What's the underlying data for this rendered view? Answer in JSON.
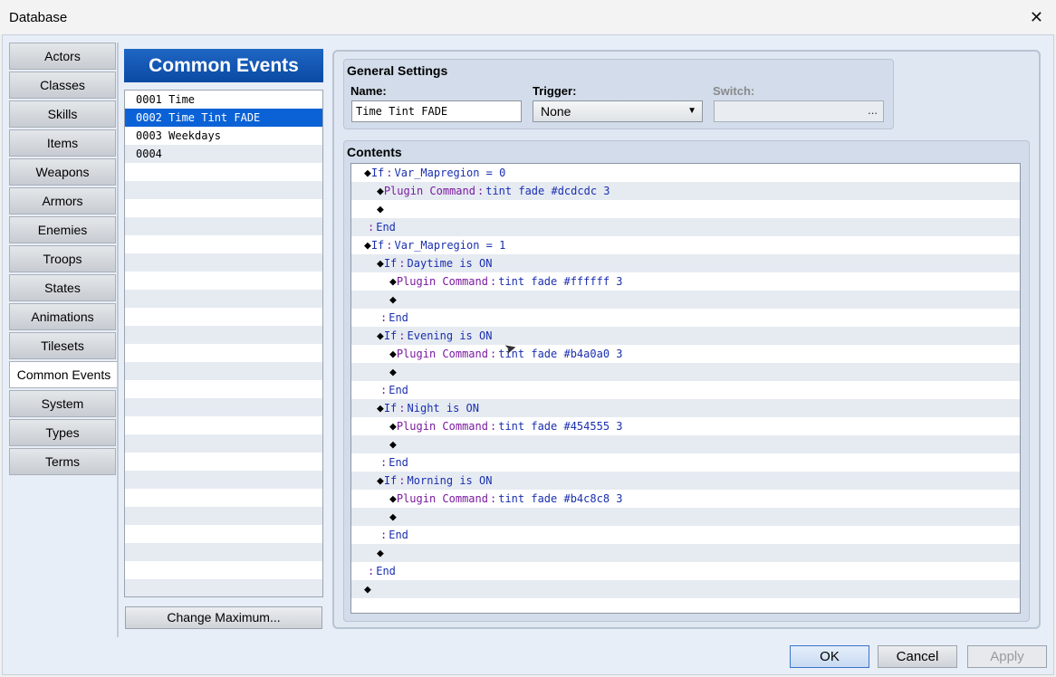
{
  "window": {
    "title": "Database",
    "close_glyph": "✕"
  },
  "tabs": [
    {
      "label": "Actors"
    },
    {
      "label": "Classes"
    },
    {
      "label": "Skills"
    },
    {
      "label": "Items"
    },
    {
      "label": "Weapons"
    },
    {
      "label": "Armors"
    },
    {
      "label": "Enemies"
    },
    {
      "label": "Troops"
    },
    {
      "label": "States"
    },
    {
      "label": "Animations"
    },
    {
      "label": "Tilesets"
    },
    {
      "label": "Common Events",
      "active": true
    },
    {
      "label": "System"
    },
    {
      "label": "Types"
    },
    {
      "label": "Terms"
    }
  ],
  "common_events": {
    "header": "Common Events",
    "items": [
      {
        "label": "0001 Time"
      },
      {
        "label": "0002 Time Tint FADE",
        "selected": true
      },
      {
        "label": "0003 Weekdays"
      },
      {
        "label": "0004"
      }
    ],
    "change_maximum": "Change Maximum..."
  },
  "general": {
    "title": "General Settings",
    "name_label": "Name:",
    "name_value": "Time Tint FADE",
    "trigger_label": "Trigger:",
    "trigger_value": "None",
    "switch_label": "Switch:",
    "switch_button": "..."
  },
  "contents": {
    "title": "Contents",
    "lines": [
      {
        "indent": 0,
        "dia": "◆",
        "kw": "If",
        "arg": "Var_Mapregion = 0",
        "type": "if"
      },
      {
        "indent": 1,
        "dia": "◆",
        "kw": "Plugin Command",
        "arg": "tint fade #dcdcdc 3",
        "type": "plugin"
      },
      {
        "indent": 1,
        "dia": "◆",
        "kw": "",
        "arg": "",
        "type": "empty"
      },
      {
        "indent": 0,
        "dia": "",
        "kw": "End",
        "arg": "",
        "type": "end"
      },
      {
        "indent": 0,
        "dia": "◆",
        "kw": "If",
        "arg": "Var_Mapregion = 1",
        "type": "if"
      },
      {
        "indent": 1,
        "dia": "◆",
        "kw": "If",
        "arg": "Daytime is ON",
        "type": "if"
      },
      {
        "indent": 2,
        "dia": "◆",
        "kw": "Plugin Command",
        "arg": "tint fade #ffffff 3",
        "type": "plugin"
      },
      {
        "indent": 2,
        "dia": "◆",
        "kw": "",
        "arg": "",
        "type": "empty"
      },
      {
        "indent": 1,
        "dia": "",
        "kw": "End",
        "arg": "",
        "type": "end"
      },
      {
        "indent": 1,
        "dia": "◆",
        "kw": "If",
        "arg": "Evening is ON",
        "type": "if"
      },
      {
        "indent": 2,
        "dia": "◆",
        "kw": "Plugin Command",
        "arg": "tint fade #b4a0a0 3",
        "type": "plugin"
      },
      {
        "indent": 2,
        "dia": "◆",
        "kw": "",
        "arg": "",
        "type": "empty"
      },
      {
        "indent": 1,
        "dia": "",
        "kw": "End",
        "arg": "",
        "type": "end"
      },
      {
        "indent": 1,
        "dia": "◆",
        "kw": "If",
        "arg": "Night is ON",
        "type": "if"
      },
      {
        "indent": 2,
        "dia": "◆",
        "kw": "Plugin Command",
        "arg": "tint fade #454555 3",
        "type": "plugin"
      },
      {
        "indent": 2,
        "dia": "◆",
        "kw": "",
        "arg": "",
        "type": "empty"
      },
      {
        "indent": 1,
        "dia": "",
        "kw": "End",
        "arg": "",
        "type": "end"
      },
      {
        "indent": 1,
        "dia": "◆",
        "kw": "If",
        "arg": "Morning is ON",
        "type": "if"
      },
      {
        "indent": 2,
        "dia": "◆",
        "kw": "Plugin Command",
        "arg": "tint fade #b4c8c8 3",
        "type": "plugin"
      },
      {
        "indent": 2,
        "dia": "◆",
        "kw": "",
        "arg": "",
        "type": "empty"
      },
      {
        "indent": 1,
        "dia": "",
        "kw": "End",
        "arg": "",
        "type": "end"
      },
      {
        "indent": 1,
        "dia": "◆",
        "kw": "",
        "arg": "",
        "type": "empty"
      },
      {
        "indent": 0,
        "dia": "",
        "kw": "End",
        "arg": "",
        "type": "end"
      },
      {
        "indent": 0,
        "dia": "◆",
        "kw": "",
        "arg": "",
        "type": "empty"
      }
    ]
  },
  "buttons": {
    "ok": "OK",
    "cancel": "Cancel",
    "apply": "Apply"
  },
  "colors": {
    "accent": "#0b62d6",
    "header": "#1f66c4",
    "keyword_if": "#1a2fb0",
    "keyword_plugin": "#7a1aa0"
  }
}
